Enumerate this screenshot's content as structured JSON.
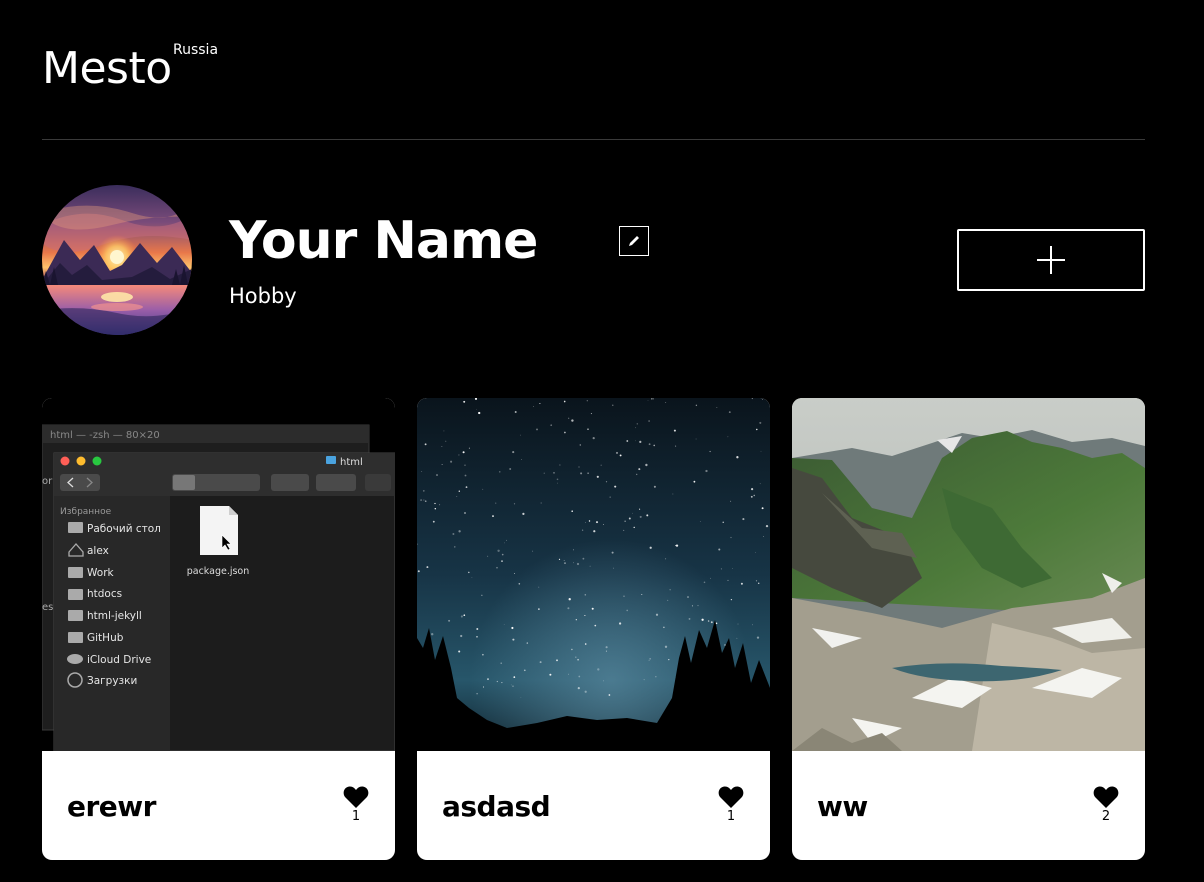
{
  "header": {
    "logo": "Mesto",
    "logo_sup": "Russia"
  },
  "profile": {
    "name": "Your Name",
    "hobby": "Hobby"
  },
  "cards": [
    {
      "title": "erewr",
      "likes": "1",
      "image": {
        "terminal_title": "html — -zsh — 80×20",
        "finder_title": "html",
        "sidebar_heading": "Избранное",
        "sidebar_items": [
          "Рабочий стол",
          "alex",
          "Work",
          "htdocs",
          "html-jekyll",
          "GitHub",
          "iCloud Drive",
          "Загрузки"
        ],
        "file_name": "package.json",
        "terminal_fragments": [
          "or",
          "es"
        ]
      }
    },
    {
      "title": "asdasd",
      "likes": "1"
    },
    {
      "title": "ww",
      "likes": "2"
    }
  ],
  "colors": {
    "background": "#000000",
    "card": "#ffffff",
    "divider": "#3a3a3a"
  },
  "icons": {
    "edit": "pencil-icon",
    "add": "plus-icon",
    "like": "heart-icon"
  }
}
